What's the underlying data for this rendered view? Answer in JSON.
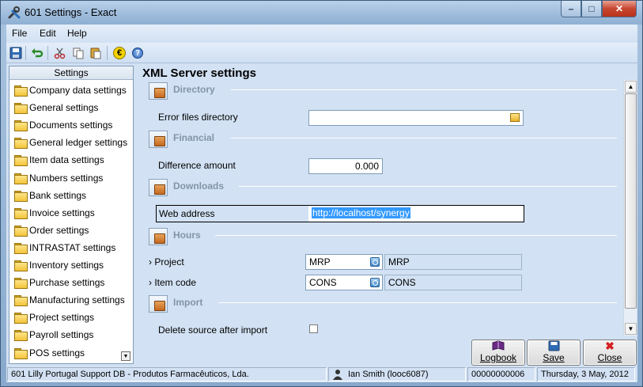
{
  "window": {
    "title": "601 Settings - Exact",
    "minimize_glyph": "–",
    "maximize_glyph": "□",
    "close_glyph": "✕"
  },
  "menu": {
    "file": "File",
    "edit": "Edit",
    "help": "Help"
  },
  "toolbar": {
    "icons": [
      "save-icon",
      "undo-icon",
      "cut-icon",
      "copy-icon",
      "paste-icon",
      "euro-icon",
      "help-icon"
    ],
    "euro_glyph": "€",
    "help_glyph": "?"
  },
  "sidebar": {
    "header": "Settings",
    "items": [
      {
        "label": "Company data settings"
      },
      {
        "label": "General settings"
      },
      {
        "label": "Documents settings"
      },
      {
        "label": "General ledger settings"
      },
      {
        "label": "Item data settings"
      },
      {
        "label": "Numbers settings"
      },
      {
        "label": "Bank settings"
      },
      {
        "label": "Invoice settings"
      },
      {
        "label": "Order settings"
      },
      {
        "label": "INTRASTAT settings"
      },
      {
        "label": "Inventory settings"
      },
      {
        "label": "Purchase settings"
      },
      {
        "label": "Manufacturing settings"
      },
      {
        "label": "Project settings"
      },
      {
        "label": "Payroll settings"
      },
      {
        "label": "POS settings"
      }
    ],
    "scroll_glyph": "▼"
  },
  "main": {
    "title": "XML Server settings",
    "sections": {
      "directory": {
        "title": "Directory",
        "error_files_directory_label": "Error files directory",
        "error_files_directory_value": ""
      },
      "financial": {
        "title": "Financial",
        "difference_amount_label": "Difference amount",
        "difference_amount_value": "0.000"
      },
      "downloads": {
        "title": "Downloads",
        "web_address_label": "Web address",
        "web_address_value": "http://localhost/synergy"
      },
      "hours": {
        "title": "Hours",
        "project_label": "› Project",
        "project_code": "MRP",
        "project_description": "MRP",
        "item_code_label": "› Item code",
        "item_code": "CONS",
        "item_description": "CONS"
      },
      "import": {
        "title": "Import",
        "delete_source_label": "Delete source after import",
        "delete_source_checked": false
      }
    },
    "scroll_up_glyph": "▲",
    "scroll_down_glyph": "▼"
  },
  "actions": {
    "logbook": "Logbook",
    "save": "Save",
    "close": "Close",
    "close_glyph": "✖"
  },
  "status": {
    "company": "601  Lilly Portugal Support DB - Produtos Farmacêuticos, Lda.",
    "user": "Ian Smith (looc6087)",
    "number": "00000000006",
    "date": "Thursday, 3 May, 2012"
  },
  "colors": {
    "accent_blue": "#d2e1f3",
    "close_red": "#c7462f",
    "selection_blue": "#3399ff"
  }
}
